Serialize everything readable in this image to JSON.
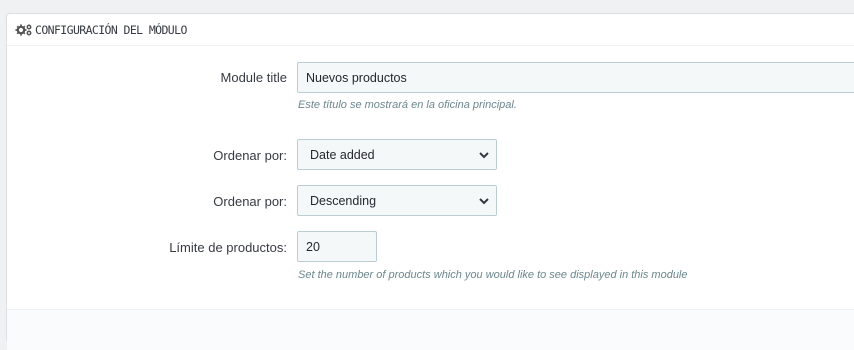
{
  "panel": {
    "title": "CONFIGURACIÓN DEL MÓDULO",
    "icon": "cogs-icon"
  },
  "fields": {
    "module_title": {
      "label": "Module title",
      "value": "Nuevos productos",
      "help": "Este título se mostrará en la oficina principal."
    },
    "order_by": {
      "label": "Ordenar por:",
      "selected": "Date added"
    },
    "order_direction": {
      "label": "Ordenar por:",
      "selected": "Descending"
    },
    "product_limit": {
      "label": "Límite de productos:",
      "value": "20",
      "help": "Set the number of products which you would like to see displayed in this module"
    }
  }
}
